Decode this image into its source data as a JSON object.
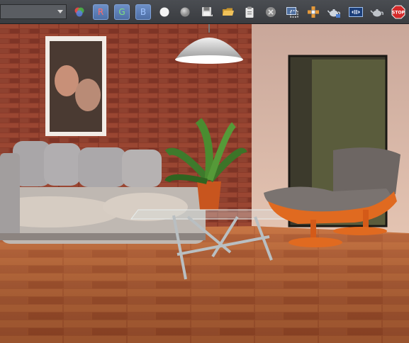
{
  "toolbar": {
    "display_select": {
      "value": ""
    },
    "channels": [
      {
        "label": "R",
        "name": "red-channel-button"
      },
      {
        "label": "G",
        "name": "green-channel-button"
      },
      {
        "label": "B",
        "name": "blue-channel-button"
      }
    ],
    "tools": [
      "rgb-color-icon",
      "white-circle-icon",
      "gray-circle-icon",
      "save-icon",
      "open-folder-icon",
      "clipboard-icon",
      "clear-icon",
      "region-render-icon",
      "tile-render-icon",
      "teapot-icon",
      "frame-buffer-icon",
      "teapot-settings-icon",
      "stop-icon"
    ],
    "stop_label": "STOP"
  },
  "viewport": {
    "scene": "rendered-interior-living-room",
    "colors": {
      "brick": "#8a3b2a",
      "wall_plaster": "#d8b8a8",
      "floor": "#a8552e",
      "sofa": "#bfb8b2",
      "chair": "#6d6663",
      "chair_base": "#e06a20"
    }
  }
}
